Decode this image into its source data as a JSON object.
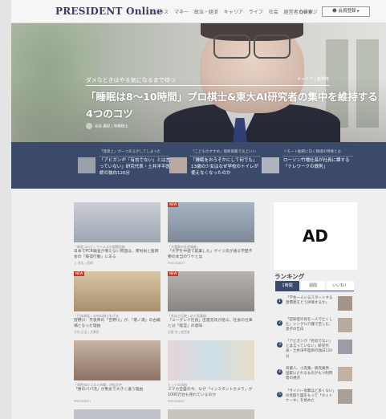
{
  "nav": {
    "logo": "PRESIDENT Online",
    "menu_items": [
      "ビジネス",
      "マネー",
      "政治・経済",
      "キャリア",
      "ライフ",
      "社会",
      "経営者カレッジ"
    ],
    "search_label": "Q検索",
    "member_label": "会員登録"
  },
  "hero": {
    "kicker": "ダメなときはやる気になるまで待つ",
    "category": "キャリア | 雑学術",
    "title_line1": "「睡眠は8～10時間」プロ棋士&東大AI研究者の集中を維持する",
    "title_line2": "4つのコツ",
    "author": "谷合 廣紀 | 将棋棋士"
  },
  "strip_items": [
    {
      "kicker": "「発達上」が一つあるがしてしまった",
      "title": "「アビガンが「有効でない」とは言っていない」研究代表・土井洋平医師の独白120分"
    },
    {
      "kicker": "「こどものすすめ」無断掲載で炎上いい",
      "title": "「睡眠をおろそかにして何でも」13歳の少女はなぜ学校のトイレが使えなくなったのか"
    },
    {
      "kicker": "リモート勤務に向く職場の特徴とは",
      "title": "ローソン竹増社長が社員に課する「テレワークの鉄則」"
    }
  ],
  "cards": [
    {
      "kicker": "「新型コロナ」ウイルスの国際比較",
      "title": "日本でPCR検査が増えない原因は、厚労省と医師会の「既得行動」にある",
      "meta": "上 昌広 | 医師"
    },
    {
      "kicker": "「大富豪の社会貢献」",
      "title": "「大学を中退で起業した」ゲイツ氏が語る学歴不要の本当のワケとは",
      "meta": "PRESIDENT"
    },
    {
      "kicker": "「日本神話」の中の知られざる",
      "title": "狩野川：奈良県の「吉野川」が、「壇ノ浦」の古戦場となった理由",
      "meta": "竹内 正浩 | 文筆家"
    },
    {
      "kicker": "「文化と伝統」の人気番組",
      "title": "「ユーグレナ社長」出雲充氏が語る、社長の仕事とは「経営」の意味",
      "meta": "出雲 充 | 経営者"
    },
    {
      "kicker": "「男性向けコスメ市場」が拡大中",
      "title": "「男のパパ活」が男女で大きく違う理由",
      "meta": "PRESIDENT"
    },
    {
      "kicker": "ヒットの法則",
      "title": "スマホ全盛の今、なぜ「インスタントカメラ」が1000万台も売れているのか",
      "meta": "PRESIDENT"
    }
  ],
  "ad_label": "AD",
  "ranking": {
    "title": "ランキング",
    "tabs": [
      "1時間",
      "週間",
      "いいね！"
    ],
    "items": [
      {
        "num": "1",
        "text": "「学生一人いるスタートする習慣者をどう評価するか」"
      },
      {
        "num": "2",
        "text": "「認知症の母を一人で亡くした」シングル介護で苦しむ、息子の告白"
      },
      {
        "num": "3",
        "text": "「アビガンが「有効でない」とは言っていない」研究代表・土井洋平医師の独白120分"
      },
      {
        "num": "4",
        "text": "商業人、小売業、販売業界…国家にされるものがもつ利用者の視点"
      },
      {
        "num": "5",
        "text": "「サイバー攻撃ほど多くない」の見取り図をもって「ホットケーキ」を始めた"
      }
    ]
  },
  "colors": {
    "brand_navy": "#3b4a6b",
    "badge_red": "#c0392b"
  }
}
